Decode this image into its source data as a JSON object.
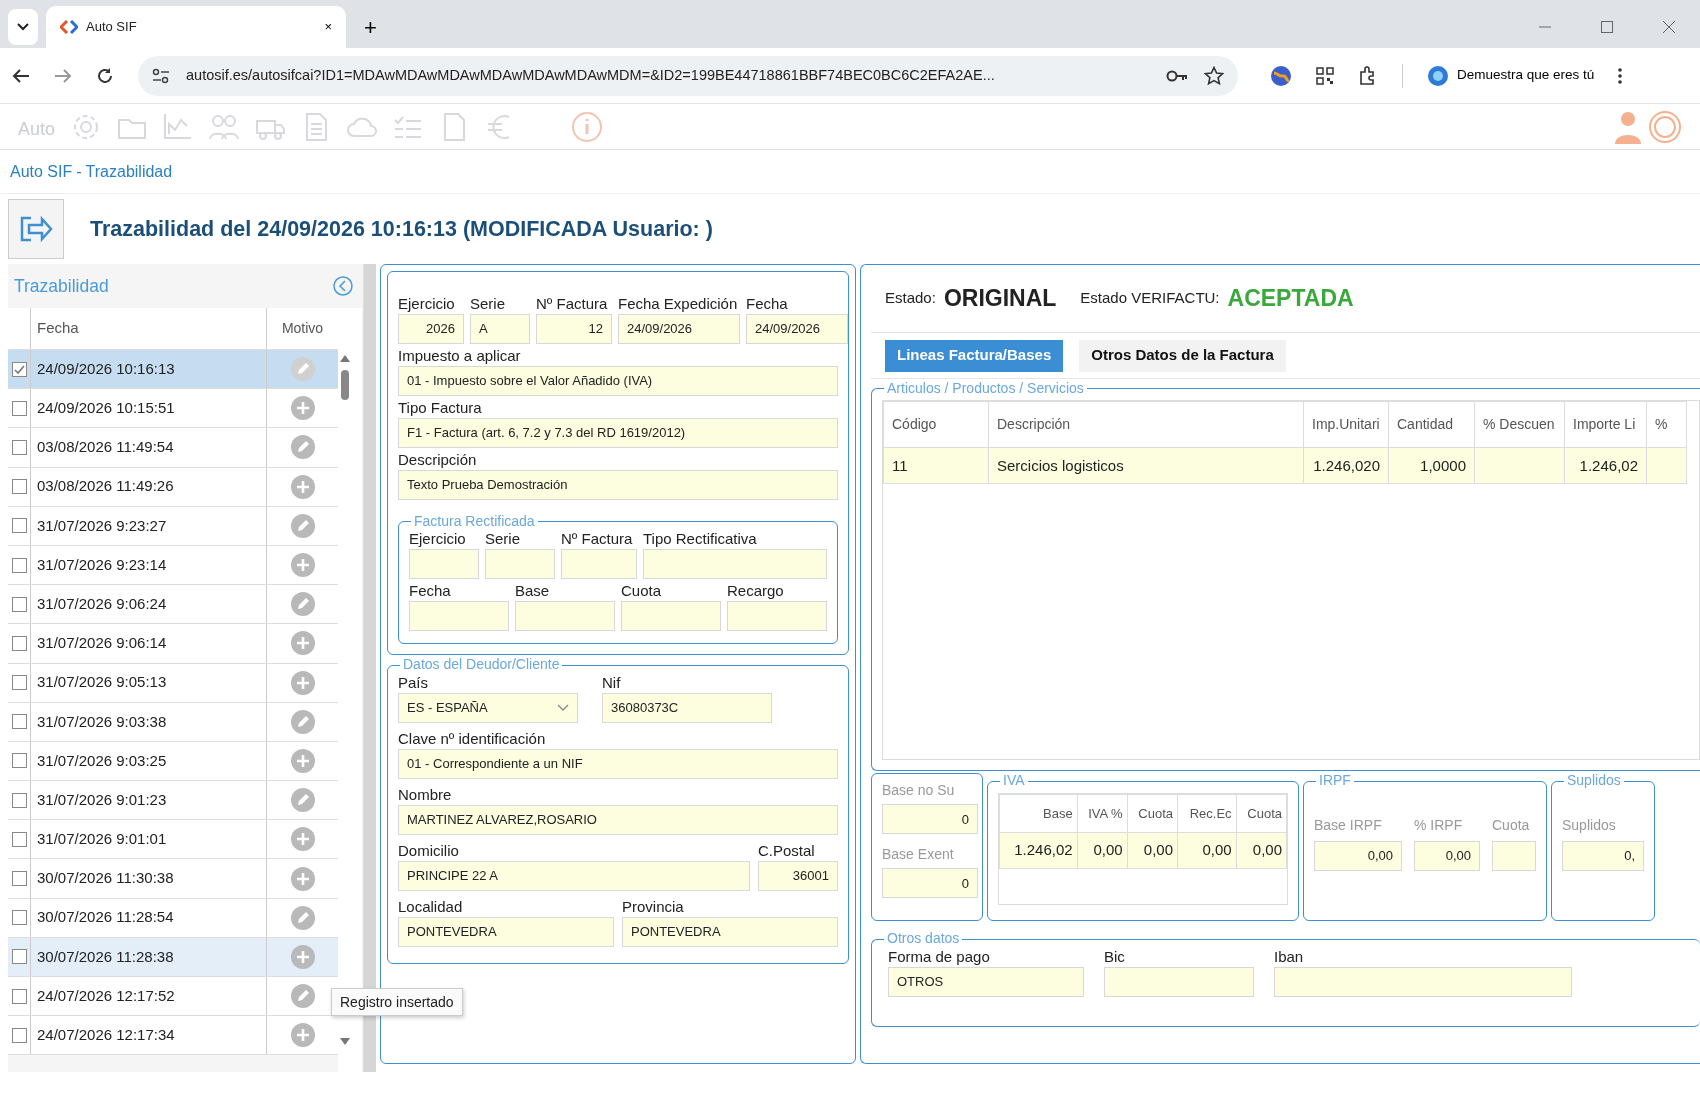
{
  "browser": {
    "tab_title": "Auto SIF",
    "tab_close": "×",
    "new_tab": "+",
    "url": "autosif.es/autosifcai?ID1=MDAwMDAwMDAwMDAwMDAwMDAwMDM=&ID2=199BE44718861BBF74BEC0BC6C2EFA2AE...",
    "profile": "Demuestra que eres tú"
  },
  "app": {
    "logo": "Auto"
  },
  "breadcrumb": {
    "home": "Auto SIF",
    "separator": "-",
    "current": "Trazabilidad"
  },
  "title": "Trazabilidad del 24/09/2026 10:16:13 (MODIFICADA Usuario: )",
  "trace": {
    "title": "Trazabilidad",
    "columns": [
      "Fecha",
      "Motivo"
    ],
    "tooltip": "Registro insertado",
    "rows": [
      {
        "date": "24/09/2026 10:16:13",
        "checked": true,
        "selected": true,
        "hovered": false,
        "kind": "edit"
      },
      {
        "date": "24/09/2026 10:15:51",
        "checked": false,
        "selected": false,
        "hovered": false,
        "kind": "insert"
      },
      {
        "date": "03/08/2026 11:49:54",
        "checked": false,
        "selected": false,
        "hovered": false,
        "kind": "edit"
      },
      {
        "date": "03/08/2026 11:49:26",
        "checked": false,
        "selected": false,
        "hovered": false,
        "kind": "insert"
      },
      {
        "date": "31/07/2026 9:23:27",
        "checked": false,
        "selected": false,
        "hovered": false,
        "kind": "edit"
      },
      {
        "date": "31/07/2026 9:23:14",
        "checked": false,
        "selected": false,
        "hovered": false,
        "kind": "insert"
      },
      {
        "date": "31/07/2026 9:06:24",
        "checked": false,
        "selected": false,
        "hovered": false,
        "kind": "edit"
      },
      {
        "date": "31/07/2026 9:06:14",
        "checked": false,
        "selected": false,
        "hovered": false,
        "kind": "insert"
      },
      {
        "date": "31/07/2026 9:05:13",
        "checked": false,
        "selected": false,
        "hovered": false,
        "kind": "insert"
      },
      {
        "date": "31/07/2026 9:03:38",
        "checked": false,
        "selected": false,
        "hovered": false,
        "kind": "edit"
      },
      {
        "date": "31/07/2026 9:03:25",
        "checked": false,
        "selected": false,
        "hovered": false,
        "kind": "insert"
      },
      {
        "date": "31/07/2026 9:01:23",
        "checked": false,
        "selected": false,
        "hovered": false,
        "kind": "edit"
      },
      {
        "date": "31/07/2026 9:01:01",
        "checked": false,
        "selected": false,
        "hovered": false,
        "kind": "insert"
      },
      {
        "date": "30/07/2026 11:30:38",
        "checked": false,
        "selected": false,
        "hovered": false,
        "kind": "insert"
      },
      {
        "date": "30/07/2026 11:28:54",
        "checked": false,
        "selected": false,
        "hovered": false,
        "kind": "edit"
      },
      {
        "date": "30/07/2026 11:28:38",
        "checked": false,
        "selected": false,
        "hovered": true,
        "kind": "insert"
      },
      {
        "date": "24/07/2026 12:17:52",
        "checked": false,
        "selected": false,
        "hovered": false,
        "kind": "edit"
      },
      {
        "date": "24/07/2026 12:17:34",
        "checked": false,
        "selected": false,
        "hovered": false,
        "kind": "insert"
      }
    ]
  },
  "invoice": {
    "rows": [
      [
        {
          "label": "Ejercicio",
          "value": "2026",
          "kind": "text",
          "numeric": true
        },
        {
          "label": "Serie",
          "value": "A",
          "kind": "text",
          "numeric": false
        },
        {
          "label": "Nº Factura",
          "value": "12",
          "kind": "text",
          "numeric": true
        },
        {
          "label": "Fecha Expedición",
          "value": "24/09/2026",
          "kind": "text",
          "numeric": false
        },
        {
          "label": "Fecha",
          "value": "24/09/2026",
          "kind": "text",
          "numeric": false
        }
      ],
      [
        {
          "label": "Impuesto a aplicar",
          "value": "01 - Impuesto sobre el Valor Añadido (IVA)",
          "kind": "text",
          "numeric": false
        }
      ],
      [
        {
          "label": "Tipo Factura",
          "value": "F1 - Factura (art. 6, 7.2 y 7.3 del RD 1619/2012)",
          "kind": "text",
          "numeric": false
        }
      ],
      [
        {
          "label": "Descripción",
          "value": "Texto Prueba Demostración",
          "kind": "text",
          "numeric": false
        }
      ]
    ],
    "rectified": {
      "title": "Factura Rectificada",
      "rows": [
        [
          {
            "label": "Ejercicio",
            "kind": "text"
          },
          {
            "label": "Serie",
            "kind": "text"
          },
          {
            "label": "Nº Factura",
            "kind": "text"
          },
          {
            "label": "Tipo Rectificativa",
            "kind": "text"
          }
        ],
        [
          {
            "label": "Fecha",
            "kind": "text"
          },
          {
            "label": "Base",
            "kind": "text"
          },
          {
            "label": "Cuota",
            "kind": "text"
          },
          {
            "label": "Recargo",
            "kind": "text"
          }
        ]
      ]
    },
    "customer": {
      "title": "Datos del Deudor/Cliente",
      "rows": [
        [
          {
            "label": "País",
            "value": "ES - ESPAÑA",
            "kind": "select"
          },
          {
            "label": "Nif",
            "value": "36080373C",
            "kind": "text",
            "numeric": false
          }
        ],
        [
          {
            "label": "Clave nº identificación",
            "value": "01 - Correspondiente a un NIF",
            "kind": "text",
            "numeric": false
          }
        ],
        [
          {
            "label": "Nombre",
            "value": "MARTINEZ ALVAREZ,ROSARIO",
            "kind": "text",
            "numeric": false
          }
        ],
        [
          {
            "label": "Domicilio",
            "value": "PRINCIPE 22 A",
            "kind": "text",
            "numeric": false
          },
          {
            "label": "C.Postal",
            "value": "36001",
            "kind": "text",
            "numeric": true
          }
        ],
        [
          {
            "label": "Localidad",
            "value": "PONTEVEDRA",
            "kind": "text",
            "numeric": false
          },
          {
            "label": "Provincia",
            "value": "PONTEVEDRA",
            "kind": "text",
            "numeric": false
          }
        ]
      ]
    }
  },
  "status": {
    "label": "Estado:",
    "value": "ORIGINAL",
    "verifactu_label": "Estado VERIFACTU:",
    "verifactu_value": "ACEPTADA"
  },
  "tabs": [
    {
      "label": "Lineas Factura/Bases",
      "selected": true
    },
    {
      "label": "Otros Datos de la Factura",
      "selected": false
    }
  ],
  "lines": {
    "title": "Articulos / Productos / Servicios",
    "columns": [
      "Código",
      "Descripción",
      "Imp.Unitari",
      "Cantidad",
      "% Descuen",
      "Importe Li",
      "%"
    ],
    "rows": [
      {
        "code": "11",
        "description": "Sercicios logisticos",
        "unit_price": "1.246,020",
        "quantity": "1,0000",
        "amount": "1.246,02"
      }
    ]
  },
  "bases": {
    "fields": [
      {
        "label": "Base no Su",
        "value": "0"
      },
      {
        "label": "Base Exent",
        "value": "0"
      }
    ]
  },
  "iva": {
    "title": "IVA",
    "columns": [
      "Base",
      "IVA %",
      "Cuota",
      "Rec.Ec",
      "Cuota"
    ],
    "rows": [
      [
        "1.246,02",
        "0,00",
        "0,00",
        "0,00",
        "0,00"
      ]
    ]
  },
  "irpf": {
    "title": "IRPF",
    "fields": [
      {
        "label": "Base IRPF",
        "value": "0,00"
      },
      {
        "label": "% IRPF",
        "value": "0,00"
      },
      {
        "label": "Cuota"
      }
    ]
  },
  "suplidos": {
    "title": "Suplidos",
    "fields": [
      {
        "label": "Suplidos",
        "value": "0,"
      }
    ]
  },
  "other": {
    "title": "Otros datos",
    "fields": [
      {
        "label": "Forma de pago",
        "value": "OTROS"
      },
      {
        "label": "Bic"
      },
      {
        "label": "Iban"
      }
    ]
  }
}
